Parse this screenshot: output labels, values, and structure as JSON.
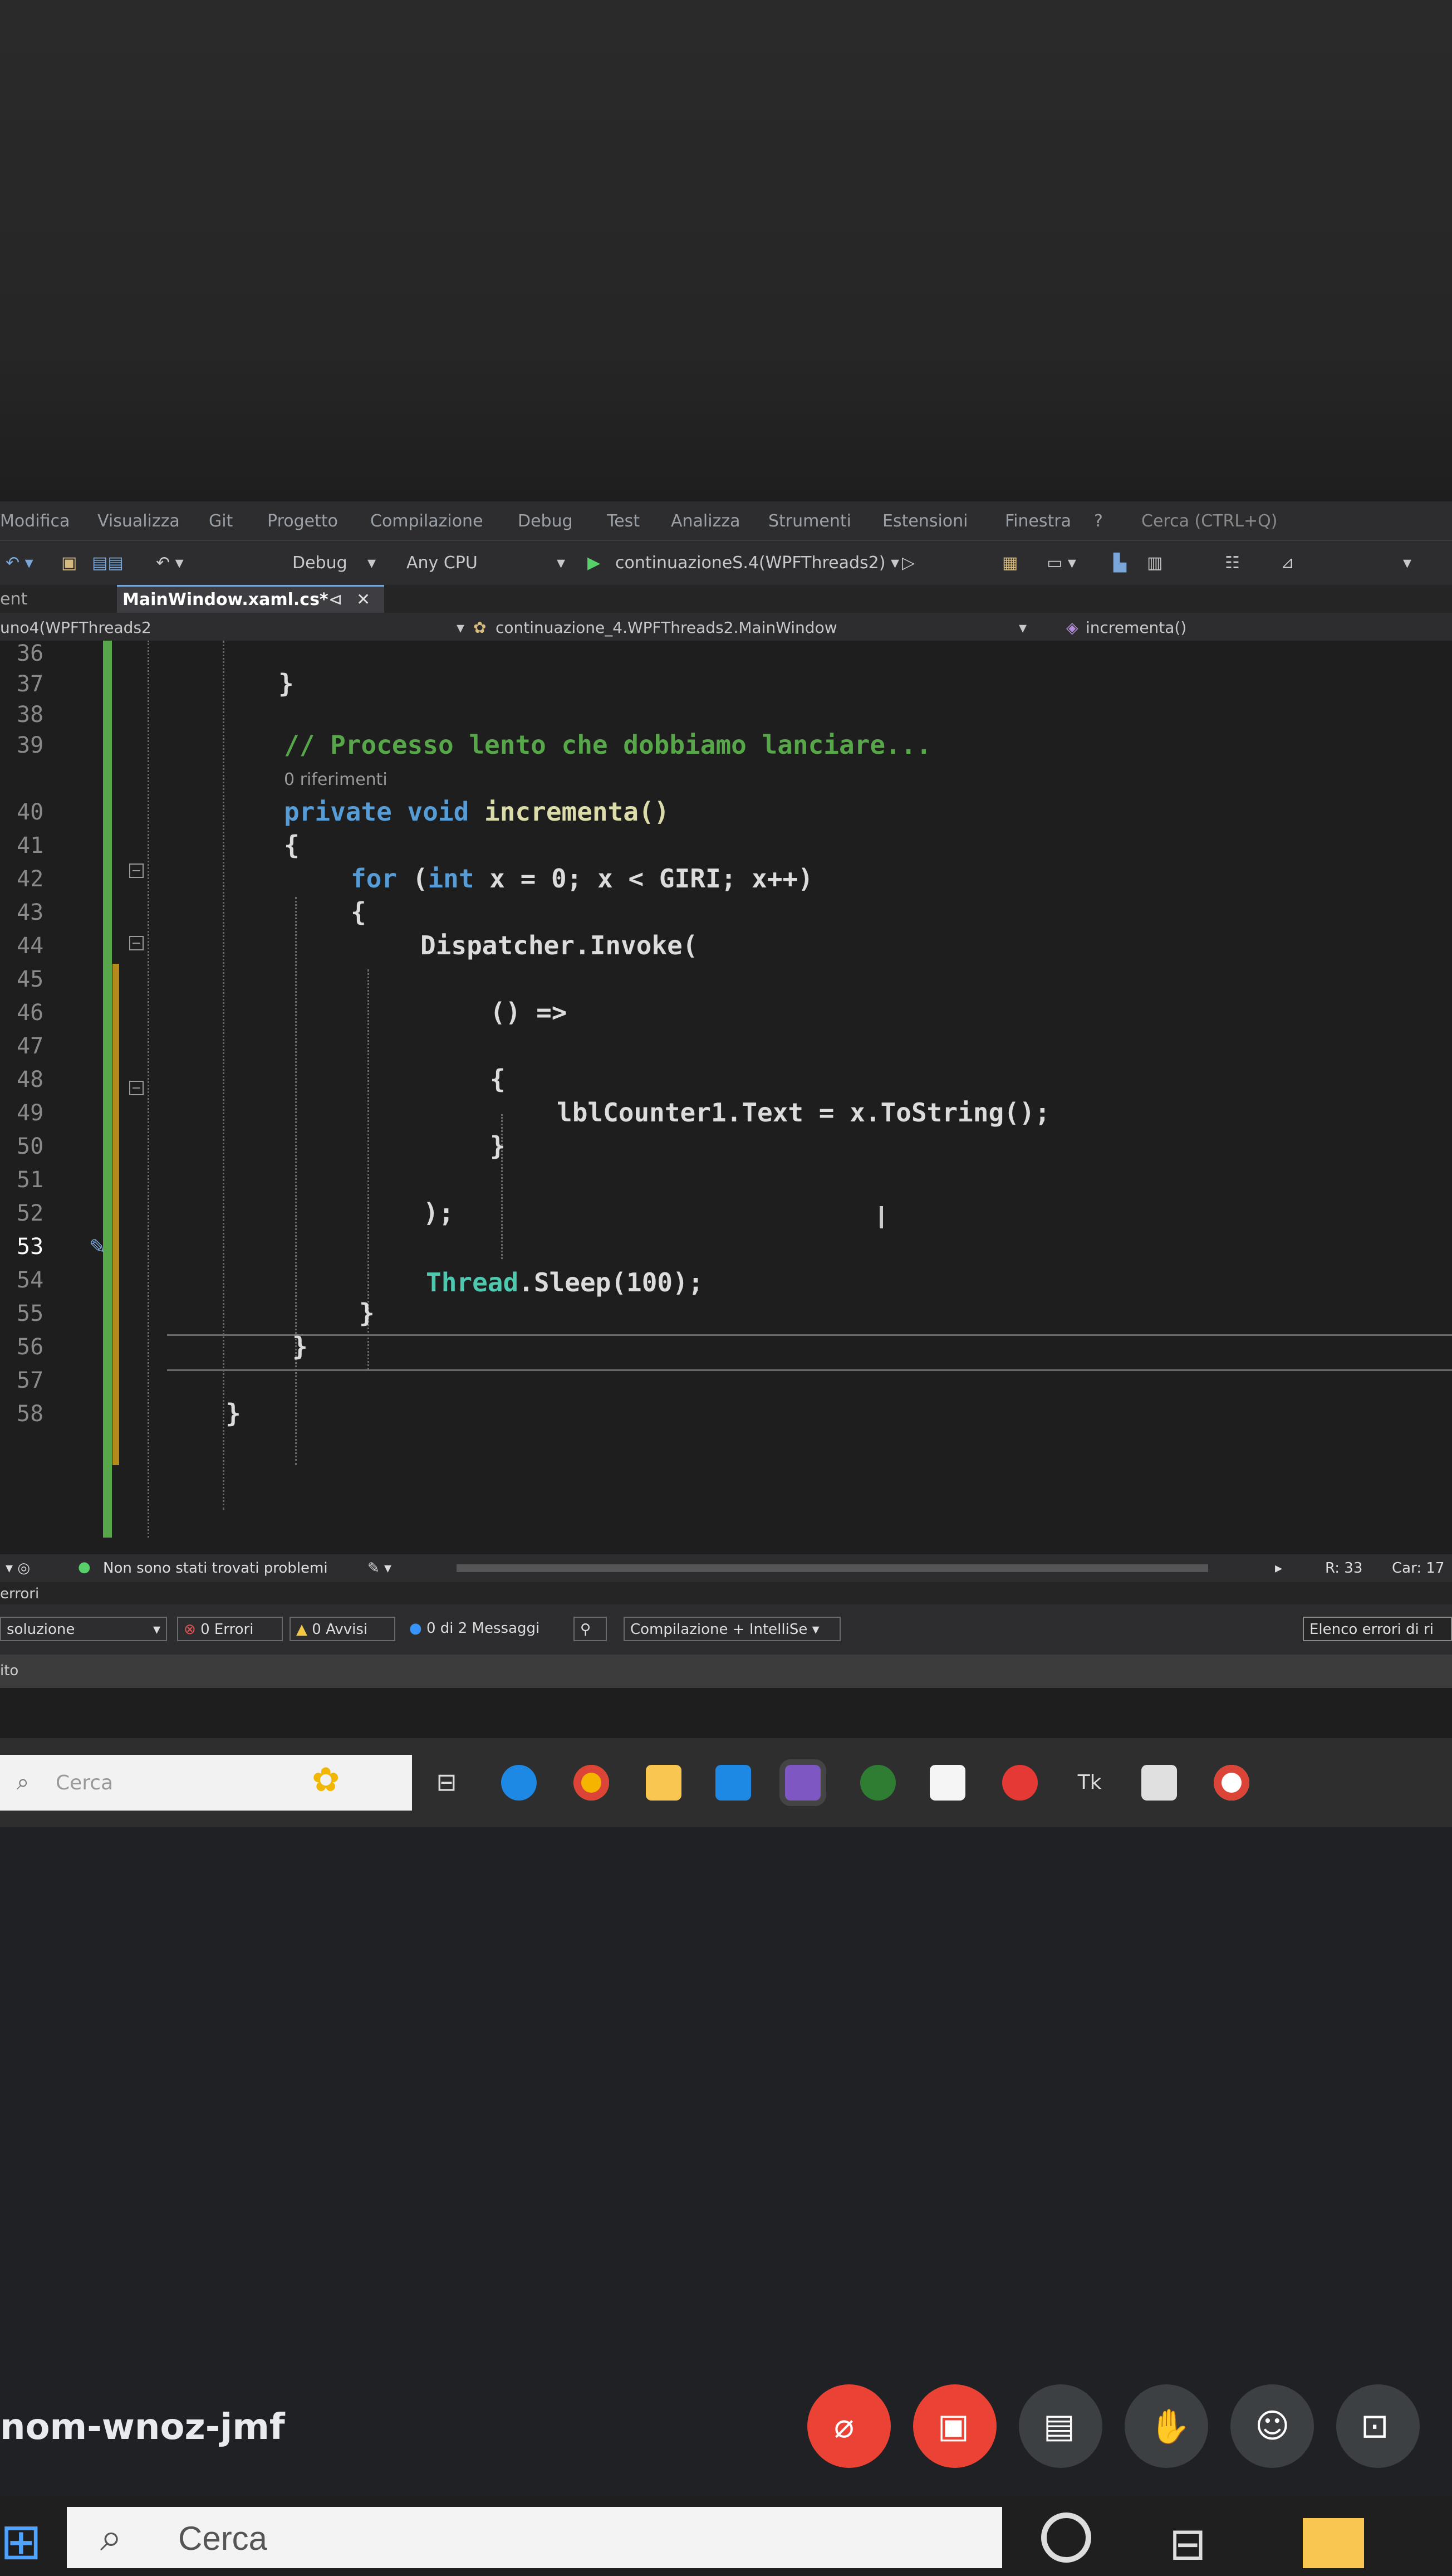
{
  "menu": {
    "items": [
      "Modifica",
      "Visualizza",
      "Git",
      "Progetto",
      "Compilazione",
      "Debug",
      "Test",
      "Analizza",
      "Strumenti",
      "Estensioni",
      "Finestra",
      "?",
      "Cerca (CTRL+Q)"
    ]
  },
  "toolbar": {
    "config": "Debug",
    "platform": "Any CPU",
    "run_target": "continuazioneS.4(WPFThreads2) ▾"
  },
  "tabs": {
    "left_fragment": "ent",
    "active_tab": "MainWindow.xaml.cs*",
    "pin": "⊲",
    "close": "✕"
  },
  "navbar": {
    "project": "uno4(WPFThreads2",
    "class": "continuazione_4.WPFThreads2.MainWindow",
    "member": "incrementa()"
  },
  "editor": {
    "lines": [
      {
        "n": "36",
        "code": ""
      },
      {
        "n": "37",
        "code": "}"
      },
      {
        "n": "38",
        "code": ""
      },
      {
        "n": "39",
        "comment": "// Processo lento che dobbiamo lanciare..."
      },
      {
        "n": "40",
        "decl_kw": "private void",
        "decl_name": "incrementa()"
      },
      {
        "n": "41",
        "code": "{"
      },
      {
        "n": "42",
        "for_kw": "for",
        "for_rest_a": " (",
        "for_int": "int",
        "for_rest_b": " x = 0; x < GIRI; x++)"
      },
      {
        "n": "43",
        "code": "{"
      },
      {
        "n": "44",
        "code": "Dispatcher.Invoke("
      },
      {
        "n": "45",
        "code": ""
      },
      {
        "n": "46",
        "code": "() =>"
      },
      {
        "n": "47",
        "code": ""
      },
      {
        "n": "48",
        "code": "{"
      },
      {
        "n": "49",
        "code": "lblCounter1.Text = x.ToString();"
      },
      {
        "n": "50",
        "code": "}"
      },
      {
        "n": "51",
        "code": ""
      },
      {
        "n": "52",
        "code": ");"
      },
      {
        "n": "53",
        "code": ""
      },
      {
        "n": "54",
        "code_type": "Thread",
        "code_rest": ".Sleep(100);"
      },
      {
        "n": "55",
        "code": "}"
      },
      {
        "n": "56",
        "code": "}"
      },
      {
        "n": "57",
        "code": ""
      },
      {
        "n": "58",
        "code": "}"
      }
    ],
    "codelens": "0 riferimenti"
  },
  "editor_status": {
    "issues": "Non sono stati trovati problemi",
    "position_line": "R: 33",
    "position_col": "Car: 17"
  },
  "error_panel": {
    "title": "errori",
    "scope": "soluzione",
    "errors": "0 Errori",
    "warnings": "0 Avvisi",
    "messages": "0 di 2 Messaggi",
    "build_filter": "Compilazione + IntelliSe ▾",
    "right_label": "Elenco errori di ri"
  },
  "output_bar": {
    "label": "ito"
  },
  "remote_taskbar": {
    "search_placeholder": "Cerca"
  },
  "meet": {
    "code": "nom-wnoz-jmf"
  },
  "host_taskbar": {
    "search_placeholder": "Cerca"
  },
  "colors": {
    "accent_blue": "#569cd6",
    "comment_green": "#57a64a",
    "type_teal": "#4ec9b0",
    "meet_red": "#ea4335"
  }
}
